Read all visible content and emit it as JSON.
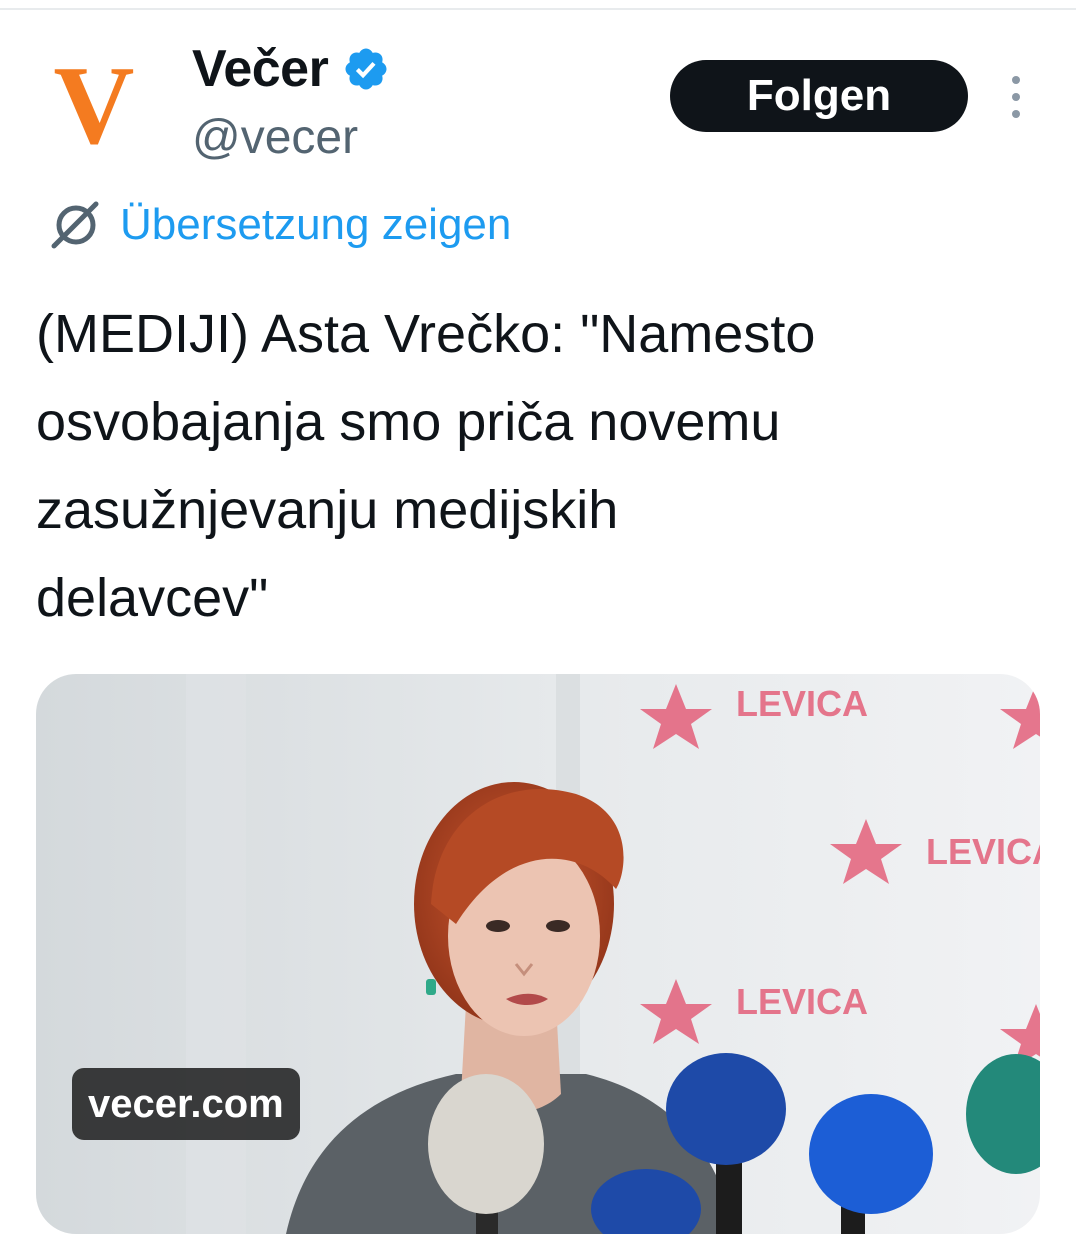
{
  "account": {
    "display_name": "Večer",
    "handle": "@vecer",
    "avatar_letter": "V",
    "avatar_color": "#f47b20",
    "verified": true
  },
  "actions": {
    "follow_label": "Folgen",
    "more_icon": "more-vertical-icon"
  },
  "translation": {
    "label": "Übersetzung zeigen",
    "icon": "globe-icon"
  },
  "tweet": {
    "text_lines": [
      "(MEDIJI) Asta Vrečko: \"Namesto",
      "osvobajanja smo priča novemu",
      "zasužnjevanju medijskih",
      "delavcev\""
    ]
  },
  "media": {
    "source": "vecer.com",
    "backdrop_text": "LEVICA"
  },
  "colors": {
    "link": "#1d9bf0",
    "text": "#0f1419",
    "secondary": "#536471",
    "button": "#0f1419",
    "backdrop_logo": "#e3607a"
  }
}
